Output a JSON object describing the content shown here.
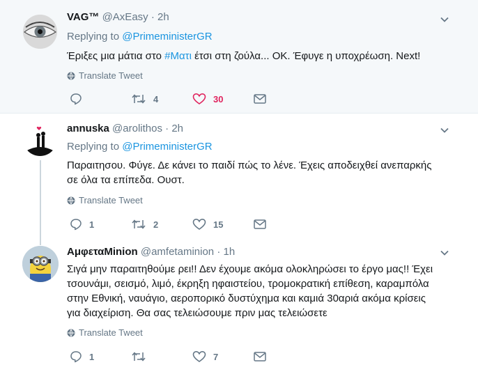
{
  "tweets": [
    {
      "name": "VAG™",
      "handle": "@AxEasy",
      "time": "2h",
      "replying_label": "Replying to",
      "replying_to": "@PrimeministerGR",
      "text_before": "Έριξες μια μάτια στο ",
      "hashtag": "#Ματι",
      "text_after": " έτσι στη ζούλα... ΟΚ. Έφυγε η υποχρέωση. Next!",
      "translate": "Translate Tweet",
      "replies": "",
      "retweets": "4",
      "likes": "30"
    },
    {
      "name": "annuska",
      "handle": "@arolithos",
      "time": "2h",
      "replying_label": "Replying to",
      "replying_to": "@PrimeministerGR",
      "text_line1": "Παραιτησου. Φύγε. Δε κάνει το παιδί πώς το λένε. Έχεις αποδειχθεί ανεπαρκής",
      "text_line2": "σε όλα τα επίπεδα. Ουστ.",
      "translate": "Translate Tweet",
      "replies": "1",
      "retweets": "2",
      "likes": "15"
    },
    {
      "name": "ΑμφεταMinion",
      "handle": "@amfetaminion",
      "time": "1h",
      "text_line1": "Σιγά μην παραιτηθούμε ρει!! Δεν έχουμε ακόμα ολοκληρώσει το έργο μας!! Έχει",
      "text_line2": "τσουνάμι, σεισμό, λιμό, έκρηξη ηφαιστείου, τρομοκρατική επίθεση, καραμπόλα",
      "text_line3": "στην Εθνική, ναυάγιο, αεροπορικό δυστύχημα και καμιά 30αριά ακόμα κρίσεις",
      "text_line4": "για διαχείριση. Θα σας τελειώσουμε πριν μας τελειώσετε",
      "translate": "Translate Tweet",
      "replies": "1",
      "retweets": "",
      "likes": "7"
    }
  ],
  "colors": {
    "accent": "#1b95e0",
    "like_active": "#e0245e",
    "muted": "#657786"
  }
}
